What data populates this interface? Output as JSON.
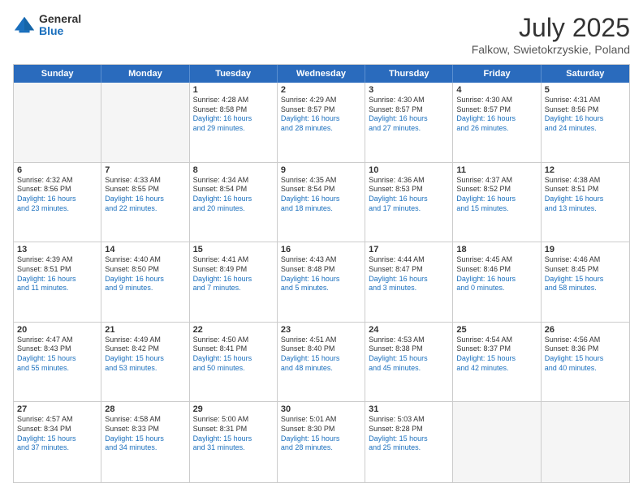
{
  "header": {
    "logo_general": "General",
    "logo_blue": "Blue",
    "month_year": "July 2025",
    "location": "Falkow, Swietokrzyskie, Poland"
  },
  "weekdays": [
    "Sunday",
    "Monday",
    "Tuesday",
    "Wednesday",
    "Thursday",
    "Friday",
    "Saturday"
  ],
  "weeks": [
    [
      {
        "day": "",
        "sunrise": "",
        "sunset": "",
        "daylight": ""
      },
      {
        "day": "",
        "sunrise": "",
        "sunset": "",
        "daylight": ""
      },
      {
        "day": "1",
        "sunrise": "Sunrise: 4:28 AM",
        "sunset": "Sunset: 8:58 PM",
        "daylight": "Daylight: 16 hours and 29 minutes."
      },
      {
        "day": "2",
        "sunrise": "Sunrise: 4:29 AM",
        "sunset": "Sunset: 8:57 PM",
        "daylight": "Daylight: 16 hours and 28 minutes."
      },
      {
        "day": "3",
        "sunrise": "Sunrise: 4:30 AM",
        "sunset": "Sunset: 8:57 PM",
        "daylight": "Daylight: 16 hours and 27 minutes."
      },
      {
        "day": "4",
        "sunrise": "Sunrise: 4:30 AM",
        "sunset": "Sunset: 8:57 PM",
        "daylight": "Daylight: 16 hours and 26 minutes."
      },
      {
        "day": "5",
        "sunrise": "Sunrise: 4:31 AM",
        "sunset": "Sunset: 8:56 PM",
        "daylight": "Daylight: 16 hours and 24 minutes."
      }
    ],
    [
      {
        "day": "6",
        "sunrise": "Sunrise: 4:32 AM",
        "sunset": "Sunset: 8:56 PM",
        "daylight": "Daylight: 16 hours and 23 minutes."
      },
      {
        "day": "7",
        "sunrise": "Sunrise: 4:33 AM",
        "sunset": "Sunset: 8:55 PM",
        "daylight": "Daylight: 16 hours and 22 minutes."
      },
      {
        "day": "8",
        "sunrise": "Sunrise: 4:34 AM",
        "sunset": "Sunset: 8:54 PM",
        "daylight": "Daylight: 16 hours and 20 minutes."
      },
      {
        "day": "9",
        "sunrise": "Sunrise: 4:35 AM",
        "sunset": "Sunset: 8:54 PM",
        "daylight": "Daylight: 16 hours and 18 minutes."
      },
      {
        "day": "10",
        "sunrise": "Sunrise: 4:36 AM",
        "sunset": "Sunset: 8:53 PM",
        "daylight": "Daylight: 16 hours and 17 minutes."
      },
      {
        "day": "11",
        "sunrise": "Sunrise: 4:37 AM",
        "sunset": "Sunset: 8:52 PM",
        "daylight": "Daylight: 16 hours and 15 minutes."
      },
      {
        "day": "12",
        "sunrise": "Sunrise: 4:38 AM",
        "sunset": "Sunset: 8:51 PM",
        "daylight": "Daylight: 16 hours and 13 minutes."
      }
    ],
    [
      {
        "day": "13",
        "sunrise": "Sunrise: 4:39 AM",
        "sunset": "Sunset: 8:51 PM",
        "daylight": "Daylight: 16 hours and 11 minutes."
      },
      {
        "day": "14",
        "sunrise": "Sunrise: 4:40 AM",
        "sunset": "Sunset: 8:50 PM",
        "daylight": "Daylight: 16 hours and 9 minutes."
      },
      {
        "day": "15",
        "sunrise": "Sunrise: 4:41 AM",
        "sunset": "Sunset: 8:49 PM",
        "daylight": "Daylight: 16 hours and 7 minutes."
      },
      {
        "day": "16",
        "sunrise": "Sunrise: 4:43 AM",
        "sunset": "Sunset: 8:48 PM",
        "daylight": "Daylight: 16 hours and 5 minutes."
      },
      {
        "day": "17",
        "sunrise": "Sunrise: 4:44 AM",
        "sunset": "Sunset: 8:47 PM",
        "daylight": "Daylight: 16 hours and 3 minutes."
      },
      {
        "day": "18",
        "sunrise": "Sunrise: 4:45 AM",
        "sunset": "Sunset: 8:46 PM",
        "daylight": "Daylight: 16 hours and 0 minutes."
      },
      {
        "day": "19",
        "sunrise": "Sunrise: 4:46 AM",
        "sunset": "Sunset: 8:45 PM",
        "daylight": "Daylight: 15 hours and 58 minutes."
      }
    ],
    [
      {
        "day": "20",
        "sunrise": "Sunrise: 4:47 AM",
        "sunset": "Sunset: 8:43 PM",
        "daylight": "Daylight: 15 hours and 55 minutes."
      },
      {
        "day": "21",
        "sunrise": "Sunrise: 4:49 AM",
        "sunset": "Sunset: 8:42 PM",
        "daylight": "Daylight: 15 hours and 53 minutes."
      },
      {
        "day": "22",
        "sunrise": "Sunrise: 4:50 AM",
        "sunset": "Sunset: 8:41 PM",
        "daylight": "Daylight: 15 hours and 50 minutes."
      },
      {
        "day": "23",
        "sunrise": "Sunrise: 4:51 AM",
        "sunset": "Sunset: 8:40 PM",
        "daylight": "Daylight: 15 hours and 48 minutes."
      },
      {
        "day": "24",
        "sunrise": "Sunrise: 4:53 AM",
        "sunset": "Sunset: 8:38 PM",
        "daylight": "Daylight: 15 hours and 45 minutes."
      },
      {
        "day": "25",
        "sunrise": "Sunrise: 4:54 AM",
        "sunset": "Sunset: 8:37 PM",
        "daylight": "Daylight: 15 hours and 42 minutes."
      },
      {
        "day": "26",
        "sunrise": "Sunrise: 4:56 AM",
        "sunset": "Sunset: 8:36 PM",
        "daylight": "Daylight: 15 hours and 40 minutes."
      }
    ],
    [
      {
        "day": "27",
        "sunrise": "Sunrise: 4:57 AM",
        "sunset": "Sunset: 8:34 PM",
        "daylight": "Daylight: 15 hours and 37 minutes."
      },
      {
        "day": "28",
        "sunrise": "Sunrise: 4:58 AM",
        "sunset": "Sunset: 8:33 PM",
        "daylight": "Daylight: 15 hours and 34 minutes."
      },
      {
        "day": "29",
        "sunrise": "Sunrise: 5:00 AM",
        "sunset": "Sunset: 8:31 PM",
        "daylight": "Daylight: 15 hours and 31 minutes."
      },
      {
        "day": "30",
        "sunrise": "Sunrise: 5:01 AM",
        "sunset": "Sunset: 8:30 PM",
        "daylight": "Daylight: 15 hours and 28 minutes."
      },
      {
        "day": "31",
        "sunrise": "Sunrise: 5:03 AM",
        "sunset": "Sunset: 8:28 PM",
        "daylight": "Daylight: 15 hours and 25 minutes."
      },
      {
        "day": "",
        "sunrise": "",
        "sunset": "",
        "daylight": ""
      },
      {
        "day": "",
        "sunrise": "",
        "sunset": "",
        "daylight": ""
      }
    ]
  ]
}
